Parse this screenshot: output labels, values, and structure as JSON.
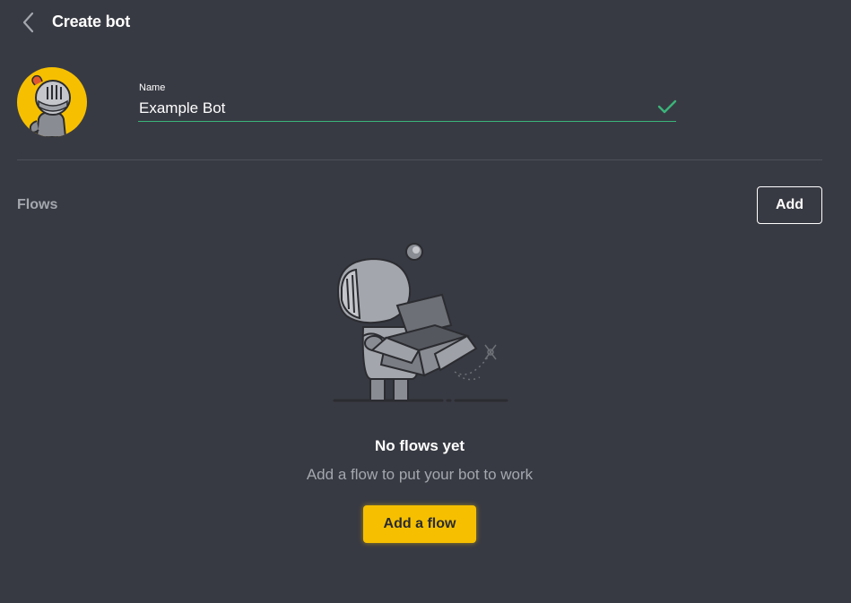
{
  "header": {
    "title": "Create bot",
    "back_icon": "chevron-left-icon"
  },
  "bot": {
    "avatar_icon": "knight-helmet-icon",
    "name_label": "Name",
    "name_value": "Example Bot",
    "name_valid_icon": "checkmark-icon"
  },
  "flows": {
    "heading": "Flows",
    "add_label": "Add",
    "empty_state": {
      "illustration": "knight-with-empty-box",
      "title": "No flows yet",
      "subtitle": "Add a flow to put your bot to work",
      "cta_label": "Add a flow"
    }
  },
  "colors": {
    "background": "#383a43",
    "accent": "#f6c000",
    "valid": "#3ab57a",
    "muted_text": "#a4a7ae",
    "divider": "#4d5059"
  }
}
